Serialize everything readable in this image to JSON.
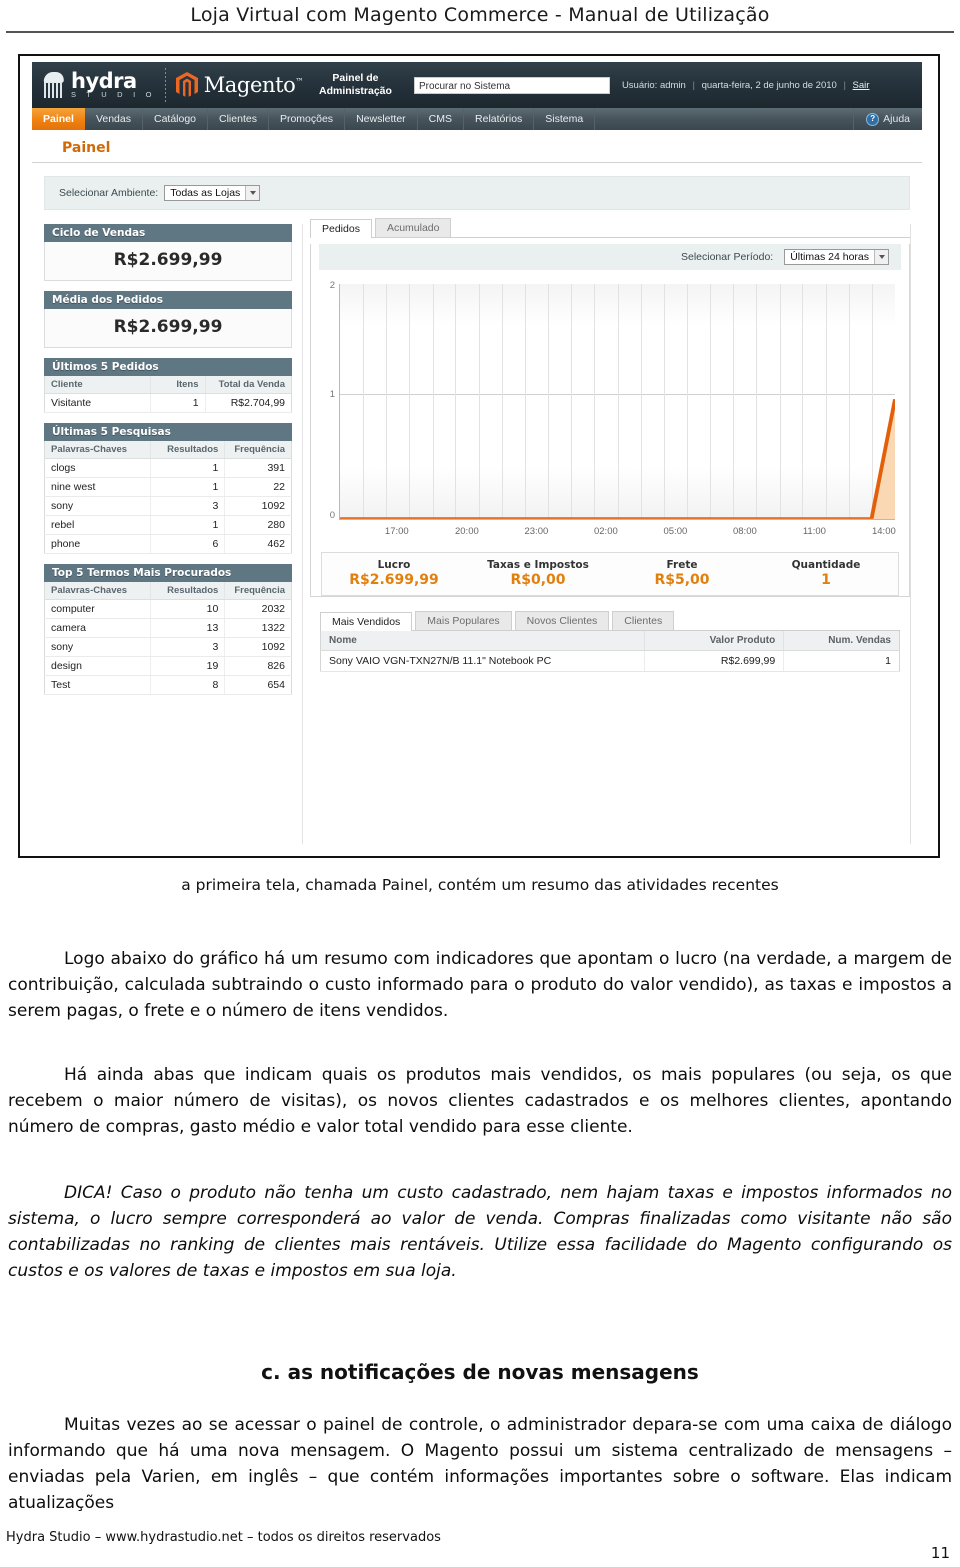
{
  "document": {
    "header_title": "Loja Virtual com Magento Commerce - Manual de Utilização",
    "caption": "a primeira tela, chamada Painel, contém um resumo das atividades recentes",
    "paragraph_1": "Logo abaixo do gráfico há um resumo com indicadores que apontam o lucro (na verdade, a margem de contribuição, calculada subtraindo o custo informado para o produto do valor vendido), as taxas e impostos a serem pagas, o frete e o número de itens vendidos.",
    "paragraph_2": "Há ainda abas que indicam quais os produtos mais vendidos, os mais populares (ou seja, os que recebem o maior número de visitas), os novos clientes cadastrados e os melhores clientes, apontando número de compras, gasto médio e valor total vendido para esse cliente.",
    "paragraph_3": "DICA! Caso o produto não tenha um custo cadastrado, nem hajam taxas e impostos informados no sistema, o lucro sempre corresponderá ao valor de venda. Compras finalizadas como visitante não são contabilizadas no ranking de clientes mais rentáveis. Utilize essa facilidade do Magento configurando os custos e os valores de taxas e impostos em sua loja.",
    "subheading": "c. as notificações de novas mensagens",
    "paragraph_4": "Muitas vezes ao se acessar o painel de controle, o administrador depara-se com uma caixa de diálogo informando que há uma nova mensagem. O Magento possui um sistema centralizado de mensagens – enviadas pela Varien, em inglês – que contém informações importantes sobre o software. Elas indicam atualizações",
    "footer": "Hydra Studio – www.hydrastudio.net – todos os direitos reservados",
    "page_number": "11"
  },
  "app": {
    "brand_primary": "hydra",
    "brand_secondary": "S T U D I O",
    "magento_wordmark": "Magento",
    "panel_subtitle_line1": "Painel de",
    "panel_subtitle_line2": "Administração",
    "search_value": "Procurar no Sistema",
    "search_placeholder": "Procurar no Sistema",
    "user_label": "Usuário: admin",
    "date_label": "quarta-feira, 2 de junho de 2010",
    "logout_label": "Sair",
    "help_label": "Ajuda",
    "nav": [
      {
        "label": "Painel",
        "active": true
      },
      {
        "label": "Vendas",
        "active": false
      },
      {
        "label": "Catálogo",
        "active": false
      },
      {
        "label": "Clientes",
        "active": false
      },
      {
        "label": "Promoções",
        "active": false
      },
      {
        "label": "Newsletter",
        "active": false
      },
      {
        "label": "CMS",
        "active": false
      },
      {
        "label": "Relatórios",
        "active": false
      },
      {
        "label": "Sistema",
        "active": false
      }
    ],
    "page_title": "Painel",
    "ambient": {
      "label": "Selecionar Ambiente:",
      "selected": "Todas as Lojas"
    },
    "colors": {
      "accent_orange": "#e2800f",
      "header_dark": "#26333c",
      "panel_head": "#5f7683",
      "chart_line": "#e2600c",
      "chart_fill": "#fbd7b0"
    }
  },
  "sidebar": {
    "lifetime_sales": {
      "title": "Ciclo de Vendas",
      "value": "R$2.699,99"
    },
    "average_orders": {
      "title": "Média dos Pedidos",
      "value": "R$2.699,99"
    },
    "last_orders": {
      "title": "Últimos 5 Pedidos",
      "columns": [
        "Cliente",
        "Itens",
        "Total da Venda"
      ],
      "rows": [
        {
          "cliente": "Visitante",
          "itens": "1",
          "total": "R$2.704,99"
        }
      ]
    },
    "last_searches": {
      "title": "Últimas 5 Pesquisas",
      "columns": [
        "Palavras-Chaves",
        "Resultados",
        "Frequência"
      ],
      "rows": [
        {
          "term": "clogs",
          "results": "1",
          "hits": "391"
        },
        {
          "term": "nine west",
          "results": "1",
          "hits": "22"
        },
        {
          "term": "sony",
          "results": "3",
          "hits": "1092"
        },
        {
          "term": "rebel",
          "results": "1",
          "hits": "280"
        },
        {
          "term": "phone",
          "results": "6",
          "hits": "462"
        }
      ]
    },
    "top_searches": {
      "title": "Top 5 Termos Mais Procurados",
      "columns": [
        "Palavras-Chaves",
        "Resultados",
        "Frequência"
      ],
      "rows": [
        {
          "term": "computer",
          "results": "10",
          "hits": "2032"
        },
        {
          "term": "camera",
          "results": "13",
          "hits": "1322"
        },
        {
          "term": "sony",
          "results": "3",
          "hits": "1092"
        },
        {
          "term": "design",
          "results": "19",
          "hits": "826"
        },
        {
          "term": "Test",
          "results": "8",
          "hits": "654"
        }
      ]
    }
  },
  "main": {
    "chart_tabs": [
      {
        "label": "Pedidos",
        "active": true
      },
      {
        "label": "Acumulado",
        "active": false
      }
    ],
    "period": {
      "label": "Selecionar Período:",
      "selected": "Últimas 24 horas"
    },
    "kpis": [
      {
        "label": "Lucro",
        "value": "R$2.699,99"
      },
      {
        "label": "Taxas e Impostos",
        "value": "R$0,00"
      },
      {
        "label": "Frete",
        "value": "R$5,00"
      },
      {
        "label": "Quantidade",
        "value": "1"
      }
    ],
    "bottom_tabs": [
      {
        "label": "Mais Vendidos",
        "active": true
      },
      {
        "label": "Mais Populares",
        "active": false
      },
      {
        "label": "Novos Clientes",
        "active": false
      },
      {
        "label": "Clientes",
        "active": false
      }
    ],
    "products": {
      "columns": [
        "Nome",
        "Valor Produto",
        "Num. Vendas"
      ],
      "rows": [
        {
          "nome": "Sony VAIO VGN-TXN27N/B 11.1\" Notebook PC",
          "valor": "R$2.699,99",
          "vendas": "1"
        }
      ]
    }
  },
  "chart_data": {
    "type": "area",
    "title": "Pedidos",
    "xlabel": "",
    "ylabel": "",
    "ylim": [
      0,
      2
    ],
    "ytick_labels": [
      "0",
      "1",
      "2"
    ],
    "ytick_values": [
      0,
      1,
      2
    ],
    "xtick_labels": [
      "17:00",
      "20:00",
      "23:00",
      "02:00",
      "05:00",
      "08:00",
      "11:00",
      "14:00"
    ],
    "grid": true,
    "legend": "none",
    "series": [
      {
        "name": "Pedidos",
        "x": [
          "15:00",
          "16:00",
          "17:00",
          "18:00",
          "19:00",
          "20:00",
          "21:00",
          "22:00",
          "23:00",
          "00:00",
          "01:00",
          "02:00",
          "03:00",
          "04:00",
          "05:00",
          "06:00",
          "07:00",
          "08:00",
          "09:00",
          "10:00",
          "11:00",
          "12:00",
          "13:00",
          "14:00"
        ],
        "values": [
          0,
          0,
          0,
          0,
          0,
          0,
          0,
          0,
          0,
          0,
          0,
          0,
          0,
          0,
          0,
          0,
          0,
          0,
          0,
          0,
          0,
          0,
          0,
          1
        ]
      }
    ]
  }
}
